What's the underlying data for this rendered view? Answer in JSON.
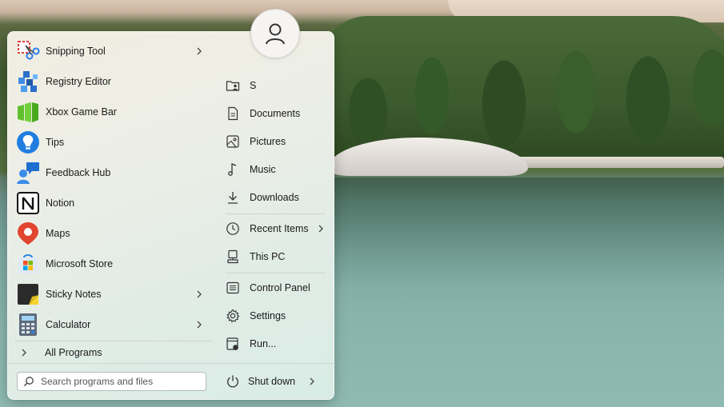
{
  "start_menu": {
    "apps": [
      {
        "label": "Snipping Tool",
        "icon": "snipping-tool-icon",
        "has_submenu": true
      },
      {
        "label": "Registry Editor",
        "icon": "registry-editor-icon",
        "has_submenu": false
      },
      {
        "label": "Xbox Game Bar",
        "icon": "xbox-game-bar-icon",
        "has_submenu": false
      },
      {
        "label": "Tips",
        "icon": "tips-icon",
        "has_submenu": false
      },
      {
        "label": "Feedback Hub",
        "icon": "feedback-hub-icon",
        "has_submenu": false
      },
      {
        "label": "Notion",
        "icon": "notion-icon",
        "has_submenu": false
      },
      {
        "label": "Maps",
        "icon": "maps-icon",
        "has_submenu": false
      },
      {
        "label": "Microsoft Store",
        "icon": "microsoft-store-icon",
        "has_submenu": false
      },
      {
        "label": "Sticky Notes",
        "icon": "sticky-notes-icon",
        "has_submenu": true
      },
      {
        "label": "Calculator",
        "icon": "calculator-icon",
        "has_submenu": true
      }
    ],
    "all_programs_label": "All Programs",
    "search": {
      "placeholder": "Search programs and files",
      "value": ""
    },
    "places": [
      {
        "label": "S",
        "icon": "user-folder-icon"
      },
      {
        "label": "Documents",
        "icon": "documents-icon"
      },
      {
        "label": "Pictures",
        "icon": "pictures-icon"
      },
      {
        "label": "Music",
        "icon": "music-icon"
      },
      {
        "label": "Downloads",
        "icon": "downloads-icon"
      },
      {
        "label": "Recent Items",
        "icon": "recent-items-icon"
      },
      {
        "label": "This PC",
        "icon": "this-pc-icon"
      },
      {
        "label": "Control Panel",
        "icon": "control-panel-icon"
      },
      {
        "label": "Settings",
        "icon": "settings-icon"
      },
      {
        "label": "Run...",
        "icon": "run-icon"
      }
    ],
    "shutdown_label": "Shut down",
    "user_avatar": "user-avatar-icon"
  },
  "colors": {
    "menu_background": "#eceee6",
    "icon_stroke": "#333333"
  }
}
